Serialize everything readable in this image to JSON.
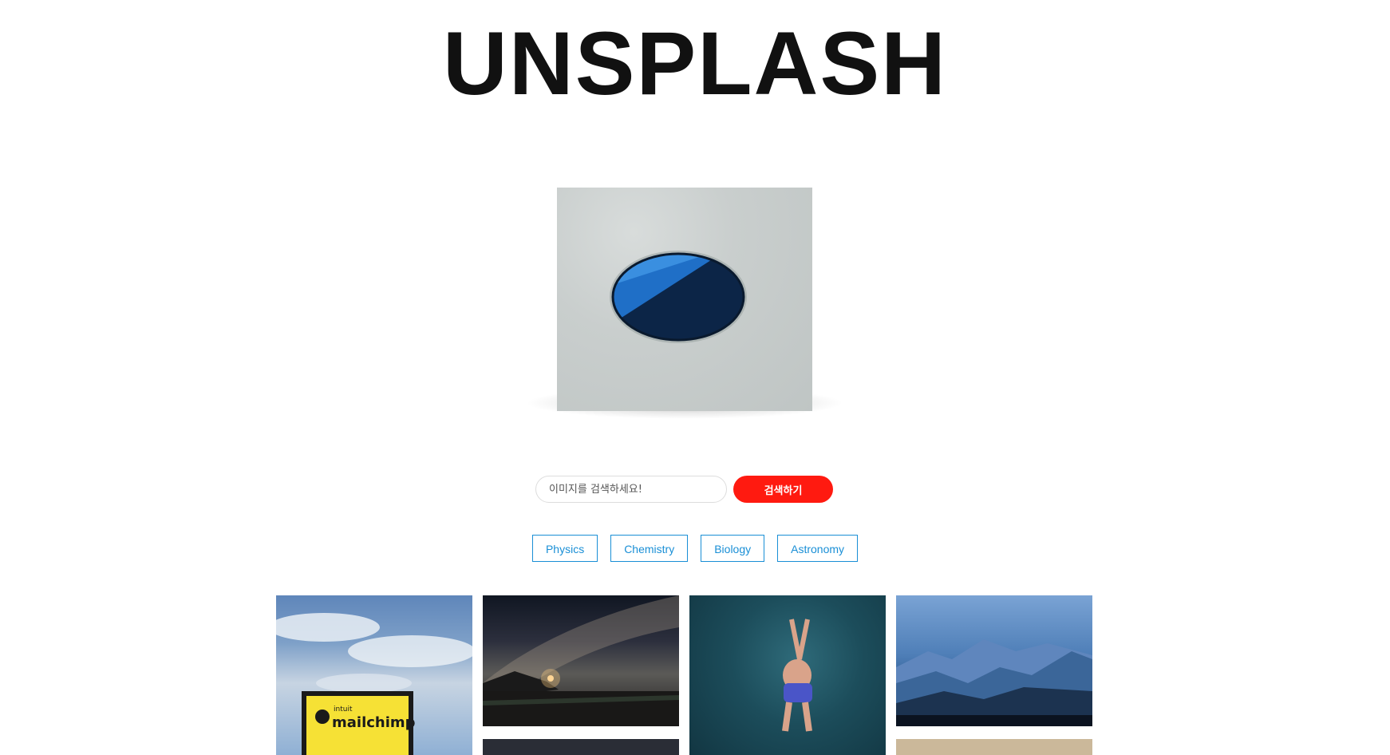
{
  "app_title": "UNSPLASH",
  "search": {
    "placeholder": "이미지를 검색하세요!",
    "button_label": "검색하기",
    "button_color": "#ff1a10"
  },
  "tags": [
    "Physics",
    "Chemistry",
    "Biology",
    "Astronomy"
  ],
  "tag_color": "#1a8fd6",
  "gallery": {
    "sign_text_small": "intuit",
    "sign_text_large": "mailchimp"
  }
}
